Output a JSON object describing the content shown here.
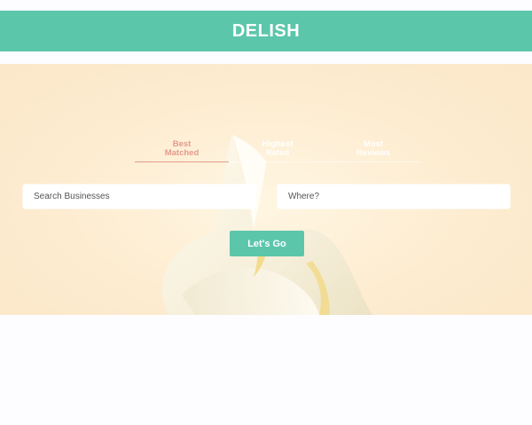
{
  "header": {
    "brand": "DELISH"
  },
  "sort_tabs": [
    {
      "line1": "Best",
      "line2": "Matched",
      "active": true
    },
    {
      "line1": "Highest",
      "line2": "Rated",
      "active": false
    },
    {
      "line1": "Most",
      "line2": "Reviews",
      "active": false
    }
  ],
  "search": {
    "business_placeholder": "Search Businesses",
    "location_placeholder": "Where?",
    "button_label": "Let's Go"
  },
  "colors": {
    "brand": "#5cc6ab",
    "active_tab": "#e49a8c",
    "hero_background": "#fdecd0"
  }
}
